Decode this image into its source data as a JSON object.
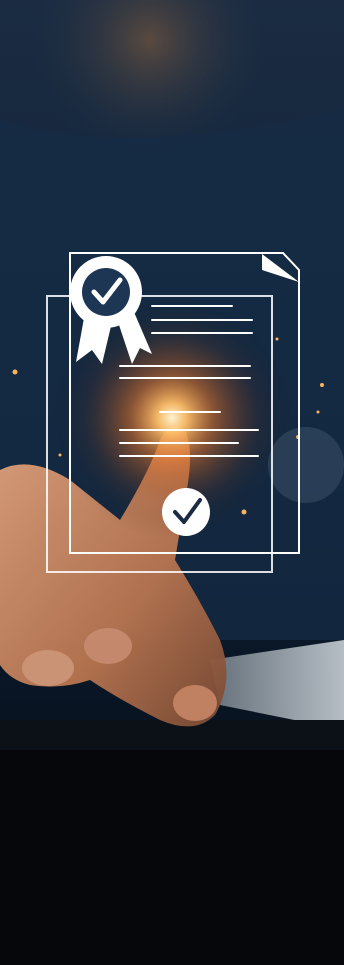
{
  "image": {
    "subject": "certificate-approval-concept",
    "icons": [
      "award-ribbon-icon",
      "document-icon",
      "checkmark-circle-icon"
    ],
    "colors": {
      "background_navy": "#0f1e31",
      "shirt_blue": "#18324f",
      "glow_orange": "#ff9a3c",
      "desk_dark": "#05070a",
      "hologram_white": "#ffffff",
      "skin": "#c98a67"
    }
  }
}
